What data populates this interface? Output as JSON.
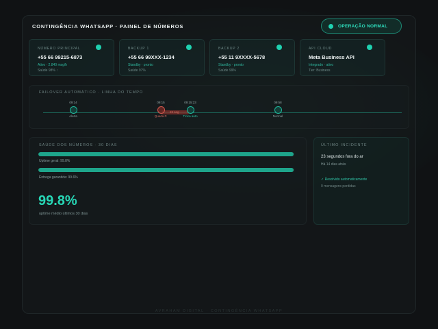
{
  "header": {
    "title": "CONTINGÊNCIA WHATSAPP · PAINEL DE NÚMEROS",
    "status": "OPERAÇÃO NORMAL"
  },
  "cards": [
    {
      "label": "NÚMERO PRINCIPAL",
      "number": "+55 66 99215-6873",
      "status": "Ativo · 2.840 msg/h",
      "health": "Saúde 98% ↑"
    },
    {
      "label": "BACKUP 1",
      "number": "+55 66 99XXX-1234",
      "status": "Standby · pronto",
      "health": "Saúde 97%"
    },
    {
      "label": "BACKUP 2",
      "number": "+55 11 9XXXX-5678",
      "status": "Standby · pronto",
      "health": "Saúde 99%"
    },
    {
      "label": "API CLOUD",
      "number": "Meta Business API",
      "status": "Integrado · ativo",
      "health": "Tier: Business"
    }
  ],
  "timeline": {
    "title": "FAILOVER AUTOMÁTICO · LINHA DO TEMPO",
    "lag": "23 seg",
    "events": [
      {
        "time": "09:14",
        "label": "Alerta",
        "kind": "normal"
      },
      {
        "time": "09:15",
        "label": "Queda P.",
        "kind": "red"
      },
      {
        "time": "09:15:23",
        "label": "Troca auto",
        "kind": "teal"
      },
      {
        "time": "09:58",
        "label": "Normal",
        "kind": "normal"
      }
    ]
  },
  "health": {
    "title": "SAÚDE DOS NÚMEROS · 30 DIAS",
    "uptime_label": "Uptime geral: 99.8%",
    "uptime_value": 99.8,
    "delivery_label": "Entrega garantida: 99.6%",
    "delivery_value": 99.6,
    "big_value": "99.8%",
    "big_caption": "uptime médio últimos 30 dias"
  },
  "incident": {
    "title": "ÚLTIMO INCIDENTE",
    "main": "23 segundos fora do ar",
    "ago": "Há 14 dias atrás",
    "resolved": "✓ Resolvido automaticamente",
    "messages": "0 mensagens perdidas"
  },
  "footer": "AVRAHAM DIGITAL · CONTINGÊNCIA WHATSAPP",
  "colors": {
    "accent": "#1fd1b0",
    "alert": "#d0584d",
    "background": "#101214"
  }
}
